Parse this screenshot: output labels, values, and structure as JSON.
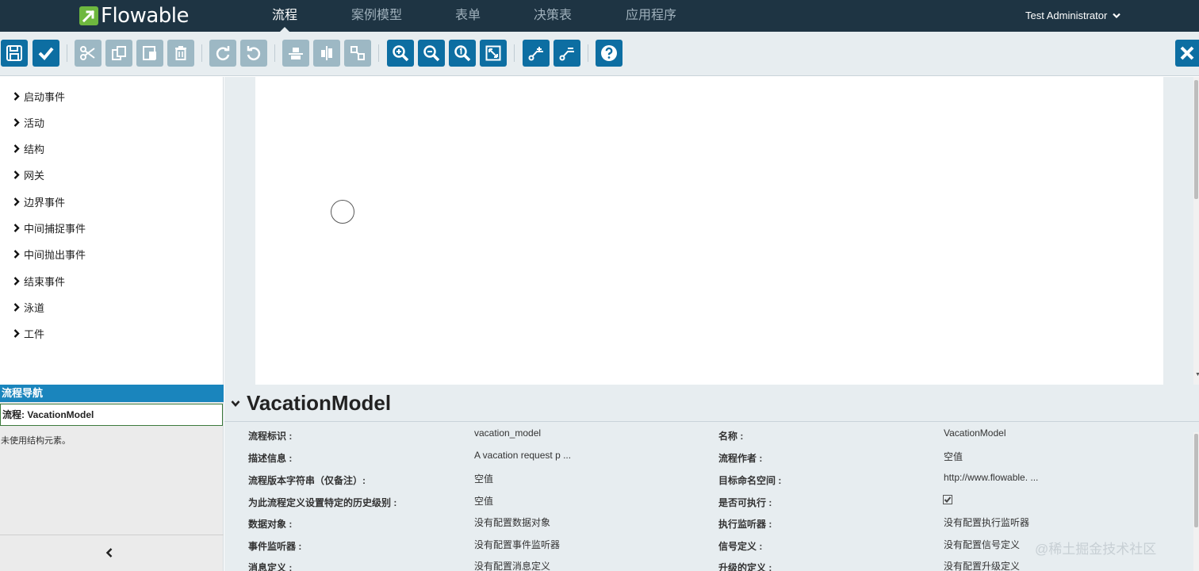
{
  "brand": {
    "name": "Flowable",
    "logo_color": "#6eb83f"
  },
  "nav": {
    "items": [
      {
        "label": "流程",
        "active": true
      },
      {
        "label": "案例模型",
        "active": false
      },
      {
        "label": "表单",
        "active": false
      },
      {
        "label": "决策表",
        "active": false
      },
      {
        "label": "应用程序",
        "active": false
      }
    ],
    "user": "Test Administrator"
  },
  "toolbar": {
    "buttons": [
      {
        "name": "save-button",
        "icon": "floppy-disk-icon",
        "enabled": true
      },
      {
        "name": "validate-button",
        "icon": "checkmark-icon",
        "enabled": true
      },
      {
        "name": "cut-button",
        "icon": "scissors-icon",
        "enabled": false
      },
      {
        "name": "copy-button",
        "icon": "copy-icon",
        "enabled": false
      },
      {
        "name": "paste-button",
        "icon": "paste-icon",
        "enabled": false
      },
      {
        "name": "delete-button",
        "icon": "trash-icon",
        "enabled": false
      },
      {
        "name": "redo-button",
        "icon": "redo-icon",
        "enabled": false
      },
      {
        "name": "undo-button",
        "icon": "undo-icon",
        "enabled": false
      },
      {
        "name": "align-vertical-button",
        "icon": "align-vertical-icon",
        "enabled": false
      },
      {
        "name": "align-horizontal-button",
        "icon": "align-horizontal-icon",
        "enabled": false
      },
      {
        "name": "same-size-button",
        "icon": "same-size-icon",
        "enabled": false
      },
      {
        "name": "zoom-in-button",
        "icon": "zoom-in-icon",
        "enabled": true
      },
      {
        "name": "zoom-out-button",
        "icon": "zoom-out-icon",
        "enabled": true
      },
      {
        "name": "zoom-actual-button",
        "icon": "zoom-actual-icon",
        "enabled": true
      },
      {
        "name": "zoom-fit-button",
        "icon": "zoom-fit-icon",
        "enabled": true
      },
      {
        "name": "add-bendpoint-button",
        "icon": "add-bendpoint-icon",
        "enabled": true
      },
      {
        "name": "remove-bendpoint-button",
        "icon": "remove-bendpoint-icon",
        "enabled": true
      },
      {
        "name": "help-button",
        "icon": "help-icon",
        "enabled": true
      }
    ],
    "accent": "#0d6ea2",
    "disabled_color": "#9db8c4"
  },
  "palette": {
    "groups": [
      "启动事件",
      "活动",
      "结构",
      "网关",
      "边界事件",
      "中间捕捉事件",
      "中间抛出事件",
      "结束事件",
      "泳道",
      "工件"
    ]
  },
  "navigator": {
    "title": "流程导航",
    "process": "流程: VacationModel",
    "empty_text": "未使用结构元素。"
  },
  "properties": {
    "title": "VacationModel",
    "rows": [
      {
        "label": "流程标识 :",
        "value": "vacation_model",
        "label2": "名称 :",
        "value2": "VacationModel"
      },
      {
        "label": "描述信息 :",
        "value": "A vacation request p ...",
        "label2": "流程作者 :",
        "value2": "空值"
      },
      {
        "label": "流程版本字符串（仅备注）:",
        "value": "空值",
        "label2": "目标命名空间 :",
        "value2": "http://www.flowable. ..."
      },
      {
        "label": "为此流程定义设置特定的历史级别 :",
        "value": "空值",
        "label2": "是否可执行 :",
        "value2": ""
      },
      {
        "label": "数据对象 :",
        "value": "没有配置数据对象",
        "label2": "执行监听器 :",
        "value2": "没有配置执行监听器"
      },
      {
        "label": "事件监听器 :",
        "value": "没有配置事件监听器",
        "label2": "信号定义 :",
        "value2": "没有配置信号定义"
      },
      {
        "label": "消息定义 :",
        "value": "没有配置消息定义",
        "label2": "升级的定义 :",
        "value2": "没有配置升级定义"
      }
    ],
    "executable_checked": true
  },
  "watermark": "@稀土掘金技术社区"
}
